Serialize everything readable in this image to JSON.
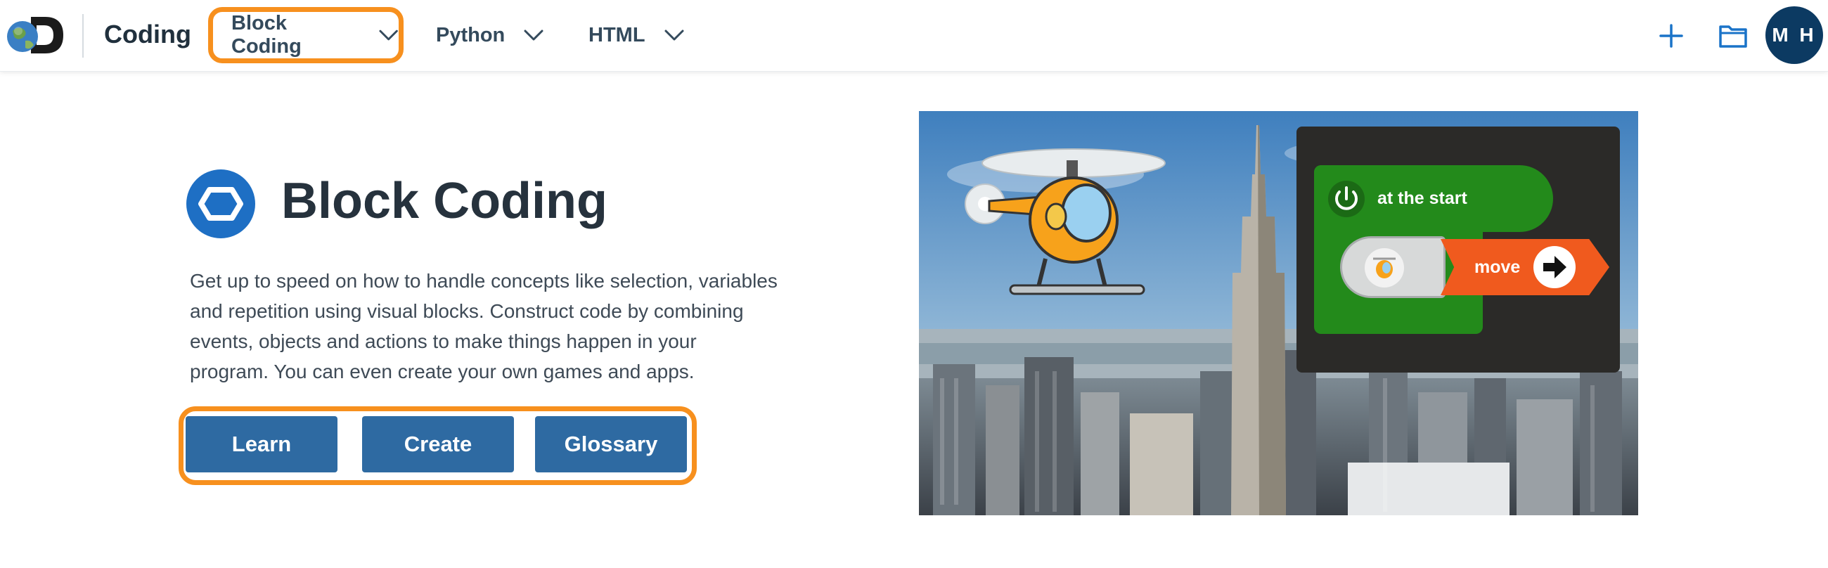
{
  "header": {
    "brand": "Coding",
    "nav": [
      {
        "label": "Block Coding",
        "active": true
      },
      {
        "label": "Python"
      },
      {
        "label": "HTML"
      }
    ],
    "avatar_initials": "M H",
    "icons": [
      "discovery-logo",
      "chevron-down-icon",
      "plus-icon",
      "folder-icon"
    ]
  },
  "hero": {
    "title": "Block Coding",
    "icon": "block-coding-icon",
    "description": "Get up to speed on how to handle concepts like selection, variables and repetition using visual blocks. Construct code by combining events, objects and actions to make things happen in your program. You can even create your own games and apps.",
    "buttons": [
      {
        "label": "Learn"
      },
      {
        "label": "Create"
      },
      {
        "label": "Glossary"
      }
    ],
    "image": {
      "block_event_label": "at the start",
      "block_action_label": "move"
    }
  },
  "colors": {
    "highlight": "#f7901e",
    "button_bg": "#2e6aa2",
    "avatar_bg": "#0c3a62",
    "icon_blue": "#1a73c8",
    "block_green": "#238a1b",
    "block_orange": "#f05a1e"
  }
}
